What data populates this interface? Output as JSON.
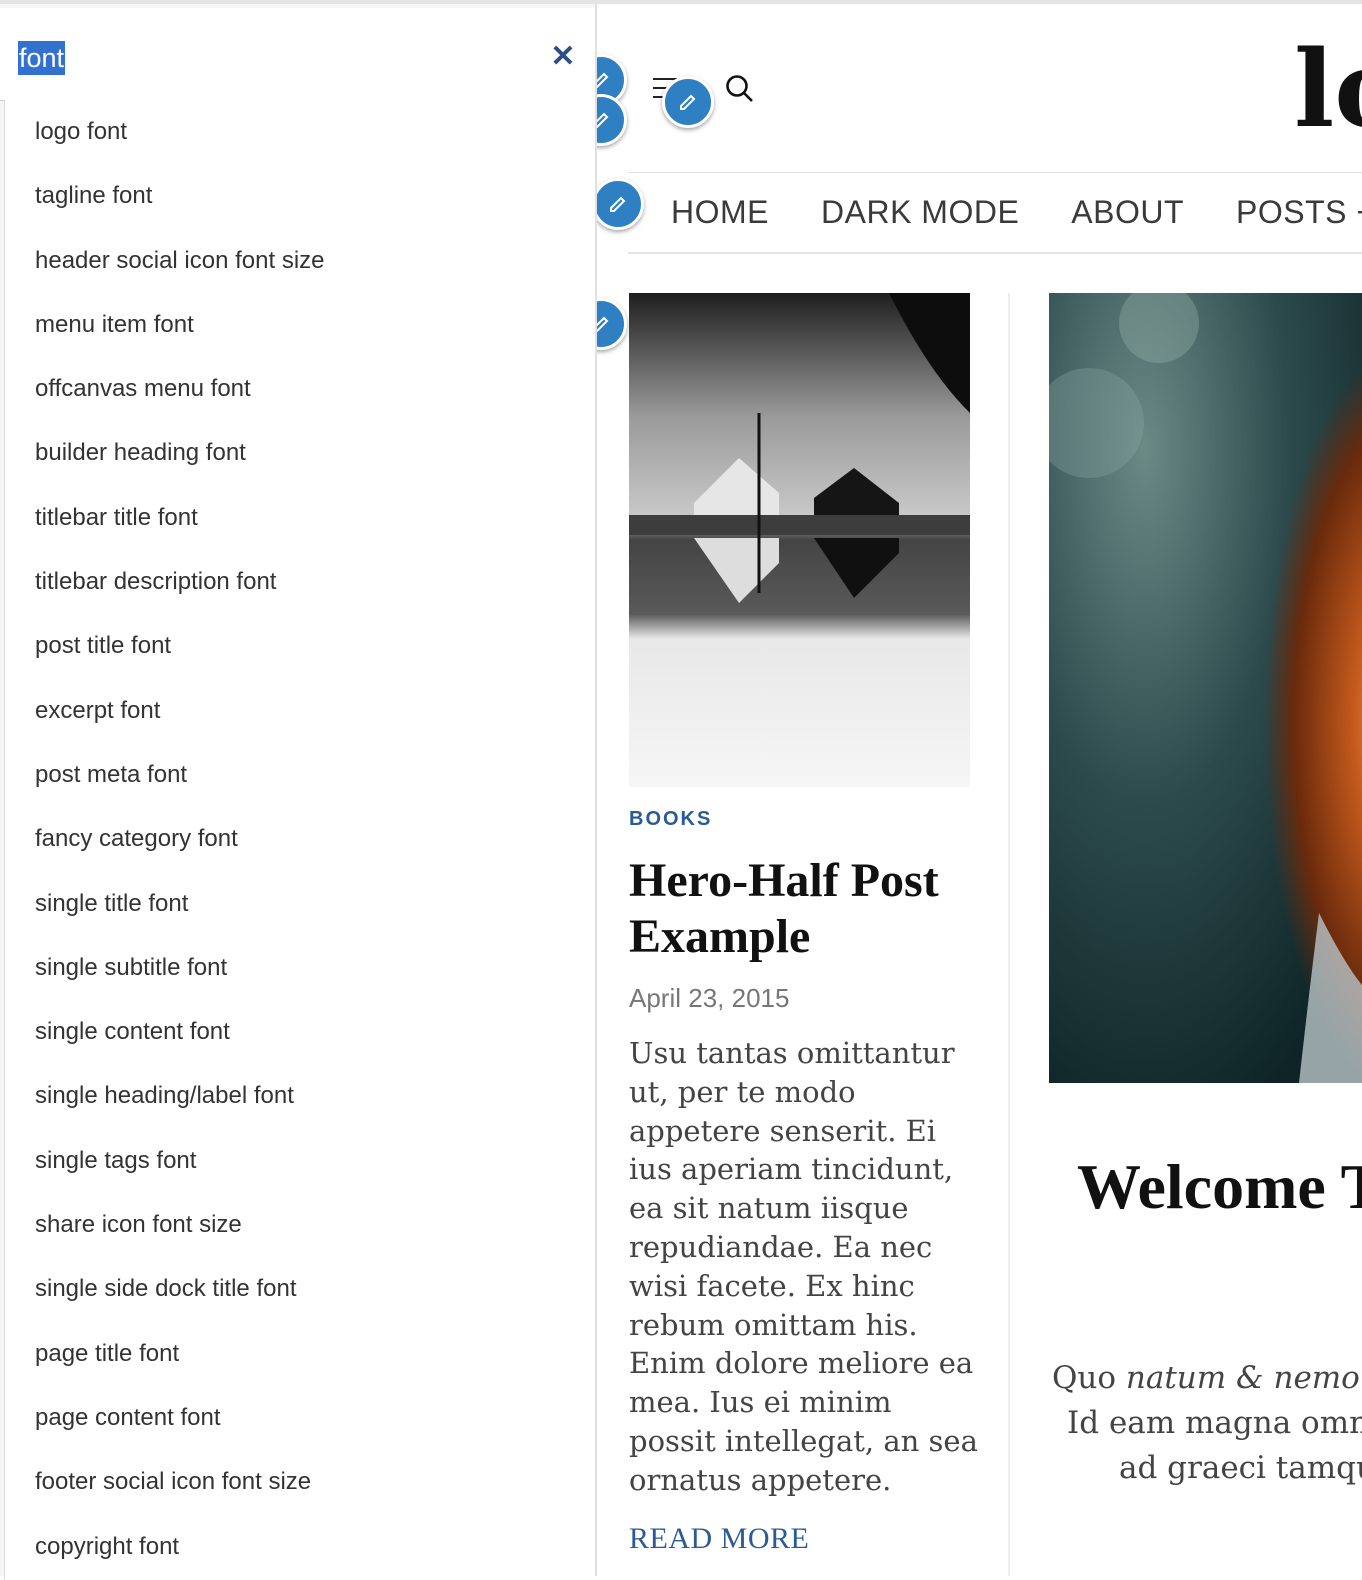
{
  "search": {
    "query": "font",
    "close_icon": "close-icon"
  },
  "results": [
    "logo font",
    "tagline font",
    "header social icon font size",
    "menu item font",
    "offcanvas menu font",
    "builder heading font",
    "titlebar title font",
    "titlebar description font",
    "post title font",
    "excerpt font",
    "post meta font",
    "fancy category font",
    "single title font",
    "single subtitle font",
    "single content font",
    "single heading/label font",
    "single tags font",
    "share icon font size",
    "single side dock title font",
    "page title font",
    "page content font",
    "footer social icon font size",
    "copyright font"
  ],
  "site": {
    "logo_text": "lo",
    "nav": [
      "HOME",
      "DARK MODE",
      "ABOUT",
      "POSTS +"
    ],
    "accent_color": "#2f7fc3",
    "link_color": "#2b5b94"
  },
  "post_left": {
    "category": "BOOKS",
    "title": "Hero-Half Post Example",
    "date": "April 23, 2015",
    "excerpt": "Usu tantas omittantur ut, per te modo appetere senserit. Ei ius aperiam tincidunt, ea sit natum iisque repudiandae. Ea nec wisi facete. Ex hinc rebum omittam his. Enim dolore meliore ea mea. Ius ei minim possit intellegat, an sea ornatus appetere.",
    "read_more": "READ MORE"
  },
  "post_right": {
    "title": "Welcome T",
    "quote_line1_a": "Quo ",
    "quote_line1_b": "natum & nemore",
    "quote_line2": "Id eam magna omnes",
    "quote_line3": "ad graeci tamqua"
  }
}
